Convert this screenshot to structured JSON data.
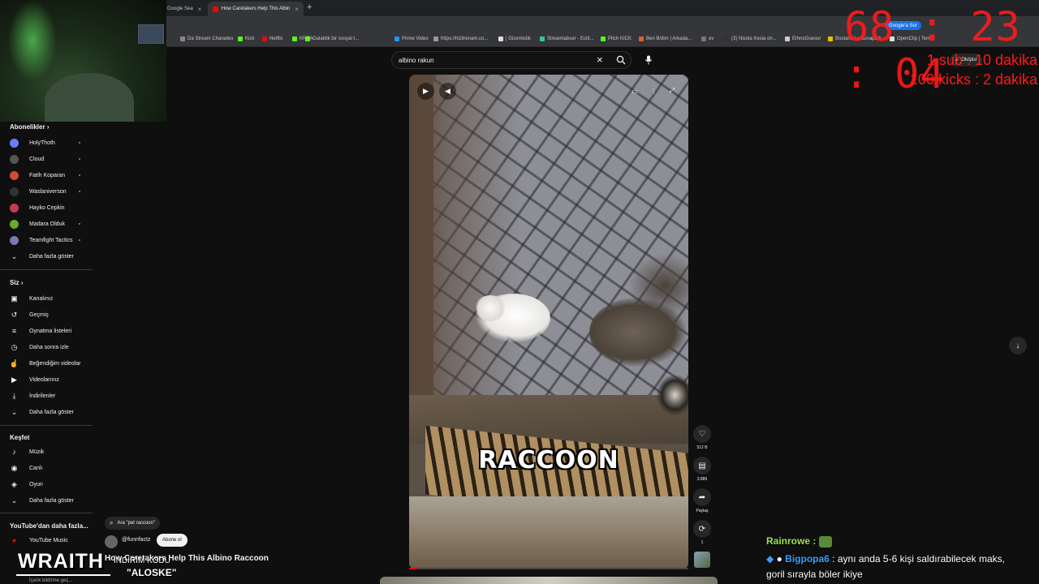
{
  "browser": {
    "tabs": [
      {
        "title": "Google Sea"
      },
      {
        "title": "How Caretakers Help This Albin"
      }
    ],
    "bookmarks": [
      "Da Stream Charades",
      "Kick",
      "Netflix",
      "KREA",
      "Galaktik bir sosyal t...",
      "Prime Video",
      "https://hizlirenam.co...",
      "| Gizemistik",
      "Streamlabser - Ecitt...",
      "Pitch KICK",
      "Ben B/dim | Arkada...",
      "ev",
      "(3) Nisola Kesla on...",
      "EthnoGuesur",
      "Bostanc Lu Lunapark",
      "OpenClip | Tem..."
    ],
    "gsor_label": "Google'a Sor"
  },
  "stream": {
    "timer": "68 : 23 : 04",
    "goal1": "1 sub : 10 dakika",
    "goal2": "100 kicks : 2 dakika",
    "brand": "WRAITH",
    "discount_label": "İNDİRİM KODU",
    "discount_code": "\"ALOSKE\"",
    "chat": [
      {
        "user": "Rainrowe",
        "message": ""
      },
      {
        "user": "Bigpopa6",
        "message": "aynı anda 5-6 kişi saldırabilecek maks,"
      },
      {
        "user": "",
        "message": "goril sırayla böler ikiye"
      }
    ]
  },
  "youtube": {
    "search": {
      "value": "albino rakun"
    },
    "create_label": "Oluştur",
    "sidebar": {
      "subs_heading": "Abonelikler",
      "subs": [
        {
          "label": "HolyThoth",
          "color": "#6a7cff",
          "dot": true
        },
        {
          "label": "Cloud",
          "color": "#555555",
          "dot": true
        },
        {
          "label": "Fatih Koparan",
          "color": "#d04a3a",
          "dot": true
        },
        {
          "label": "Waslaniverson",
          "color": "#333333",
          "dot": true
        },
        {
          "label": "Hayko Cepkin",
          "color": "#c83a50",
          "dot": false
        },
        {
          "label": "Madara Olduk",
          "color": "#6aa830",
          "dot": true
        },
        {
          "label": "Teamfight Tactics",
          "color": "#7a7ab0",
          "dot": true
        }
      ],
      "subs_more": "Daha fazla göster",
      "you_heading": "Siz",
      "you": [
        {
          "label": "Kanalınız",
          "icon": "channel-icon",
          "glyph": "▣"
        },
        {
          "label": "Geçmiş",
          "icon": "history-icon",
          "glyph": "↺"
        },
        {
          "label": "Oynatma listeleri",
          "icon": "playlists-icon",
          "glyph": "≡"
        },
        {
          "label": "Daha sonra izle",
          "icon": "watch-later-icon",
          "glyph": "◷"
        },
        {
          "label": "Beğendiğim videolar",
          "icon": "liked-icon",
          "glyph": "👍"
        },
        {
          "label": "Videolarınız",
          "icon": "your-videos-icon",
          "glyph": "▶"
        },
        {
          "label": "İndirilenler",
          "icon": "downloads-icon",
          "glyph": "⤓"
        }
      ],
      "you_more": "Daha fazla göster",
      "explore_heading": "Keşfet",
      "explore": [
        {
          "label": "Müzik",
          "icon": "music-icon",
          "glyph": "♪"
        },
        {
          "label": "Canlı",
          "icon": "live-icon",
          "glyph": "◉"
        },
        {
          "label": "Oyun",
          "icon": "gaming-icon",
          "glyph": "🎮"
        }
      ],
      "explore_more": "Daha fazla göster",
      "more_heading": "YouTube'dan daha fazla...",
      "more": [
        {
          "label": "YouTube Music",
          "icon": "youtube-music-icon"
        }
      ],
      "bottom_item": "İçerik bildirme geç..."
    },
    "short": {
      "caption": "RACCOON",
      "likes": "512 B",
      "comments": "3.886",
      "share": "Paylaş",
      "remix": "1",
      "progress": 0.03,
      "related_label": "Ara \"pet raccoon\"",
      "channel": "@funnfactz",
      "subscribe_label": "Abone ol",
      "title": "How Caretakers Help This Albino Raccoon"
    }
  }
}
